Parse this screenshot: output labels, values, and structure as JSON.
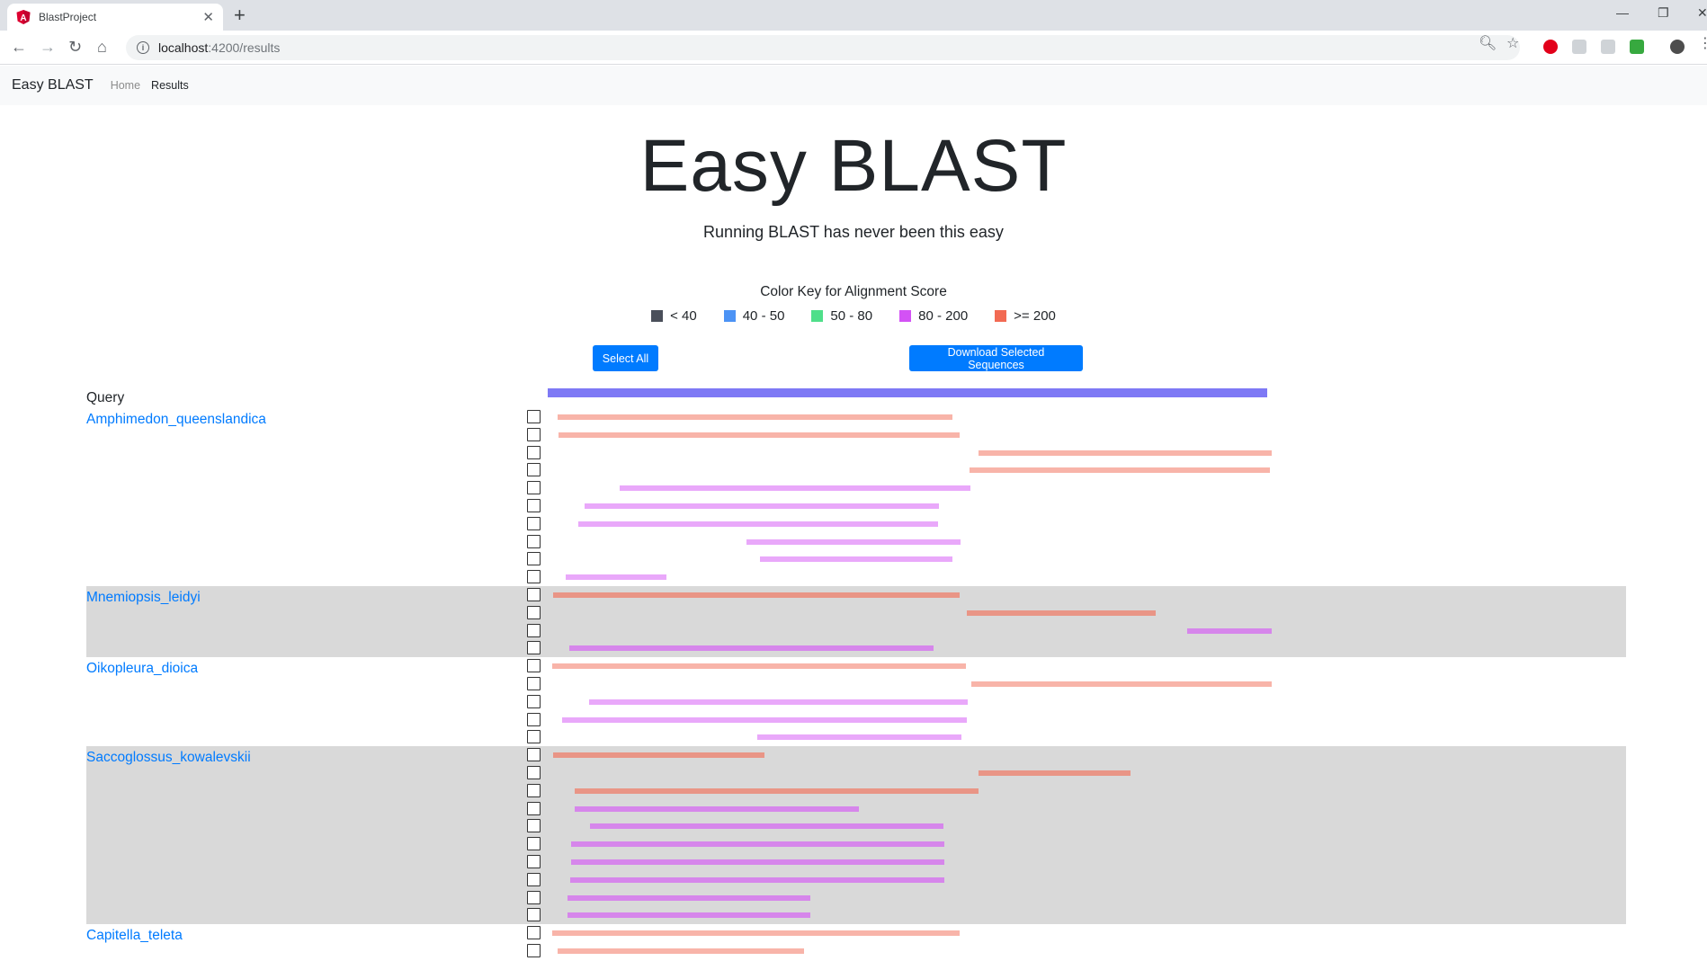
{
  "browser": {
    "tab_title": "BlastProject",
    "url_host": "localhost",
    "url_path": ":4200/results"
  },
  "navbar": {
    "brand": "Easy BLAST",
    "links": [
      "Home",
      "Results"
    ]
  },
  "hero": {
    "title": "Easy BLAST",
    "subtitle": "Running BLAST has never been this easy"
  },
  "color_key": {
    "title": "Color Key for Alignment Score",
    "items": [
      {
        "label": "< 40",
        "color": "#4a4f5a"
      },
      {
        "label": "40 - 50",
        "color": "#4c93f5"
      },
      {
        "label": "50 - 80",
        "color": "#4fdf8a"
      },
      {
        "label": "80 - 200",
        "color": "#d352f5"
      },
      {
        "label": ">= 200",
        "color": "#f26a53"
      }
    ]
  },
  "buttons": {
    "select_all": "Select All",
    "download": "Download Selected Sequences"
  },
  "query_label": "Query",
  "species": [
    {
      "name": "Amphimedon_queenslandica",
      "shaded": false,
      "hits": [
        {
          "start": 0.015,
          "end": 0.56,
          "tier": ">= 200"
        },
        {
          "start": 0.016,
          "end": 0.569,
          "tier": ">= 200"
        },
        {
          "start": 0.596,
          "end": 1.0,
          "tier": ">= 200"
        },
        {
          "start": 0.583,
          "end": 0.998,
          "tier": ">= 200"
        },
        {
          "start": 0.101,
          "end": 0.585,
          "tier": "80 - 200"
        },
        {
          "start": 0.052,
          "end": 0.541,
          "tier": "80 - 200"
        },
        {
          "start": 0.043,
          "end": 0.54,
          "tier": "80 - 200"
        },
        {
          "start": 0.276,
          "end": 0.571,
          "tier": "80 - 200"
        },
        {
          "start": 0.294,
          "end": 0.56,
          "tier": "80 - 200"
        },
        {
          "start": 0.026,
          "end": 0.165,
          "tier": "80 - 200"
        }
      ]
    },
    {
      "name": "Mnemiopsis_leidyi",
      "shaded": true,
      "hits": [
        {
          "start": 0.009,
          "end": 0.569,
          "tier": ">= 200"
        },
        {
          "start": 0.58,
          "end": 0.84,
          "tier": ">= 200"
        },
        {
          "start": 0.883,
          "end": 1.0,
          "tier": "80 - 200"
        },
        {
          "start": 0.031,
          "end": 0.533,
          "tier": "80 - 200"
        }
      ]
    },
    {
      "name": "Oikopleura_dioica",
      "shaded": false,
      "hits": [
        {
          "start": 0.008,
          "end": 0.578,
          "tier": ">= 200"
        },
        {
          "start": 0.586,
          "end": 1.0,
          "tier": ">= 200"
        },
        {
          "start": 0.058,
          "end": 0.581,
          "tier": "80 - 200"
        },
        {
          "start": 0.021,
          "end": 0.58,
          "tier": "80 - 200"
        },
        {
          "start": 0.29,
          "end": 0.572,
          "tier": "80 - 200"
        }
      ]
    },
    {
      "name": "Saccoglossus_kowalevskii",
      "shaded": true,
      "hits": [
        {
          "start": 0.009,
          "end": 0.3,
          "tier": ">= 200"
        },
        {
          "start": 0.595,
          "end": 0.805,
          "tier": ">= 200"
        },
        {
          "start": 0.038,
          "end": 0.595,
          "tier": ">= 200"
        },
        {
          "start": 0.038,
          "end": 0.431,
          "tier": "80 - 200"
        },
        {
          "start": 0.059,
          "end": 0.547,
          "tier": "80 - 200"
        },
        {
          "start": 0.033,
          "end": 0.549,
          "tier": "80 - 200"
        },
        {
          "start": 0.033,
          "end": 0.548,
          "tier": "80 - 200"
        },
        {
          "start": 0.032,
          "end": 0.549,
          "tier": "80 - 200"
        },
        {
          "start": 0.029,
          "end": 0.364,
          "tier": "80 - 200"
        },
        {
          "start": 0.029,
          "end": 0.364,
          "tier": "80 - 200"
        }
      ]
    },
    {
      "name": "Capitella_teleta",
      "shaded": false,
      "hits": [
        {
          "start": 0.008,
          "end": 0.569,
          "tier": ">= 200"
        },
        {
          "start": 0.015,
          "end": 0.355,
          "tier": ">= 200"
        }
      ]
    }
  ]
}
